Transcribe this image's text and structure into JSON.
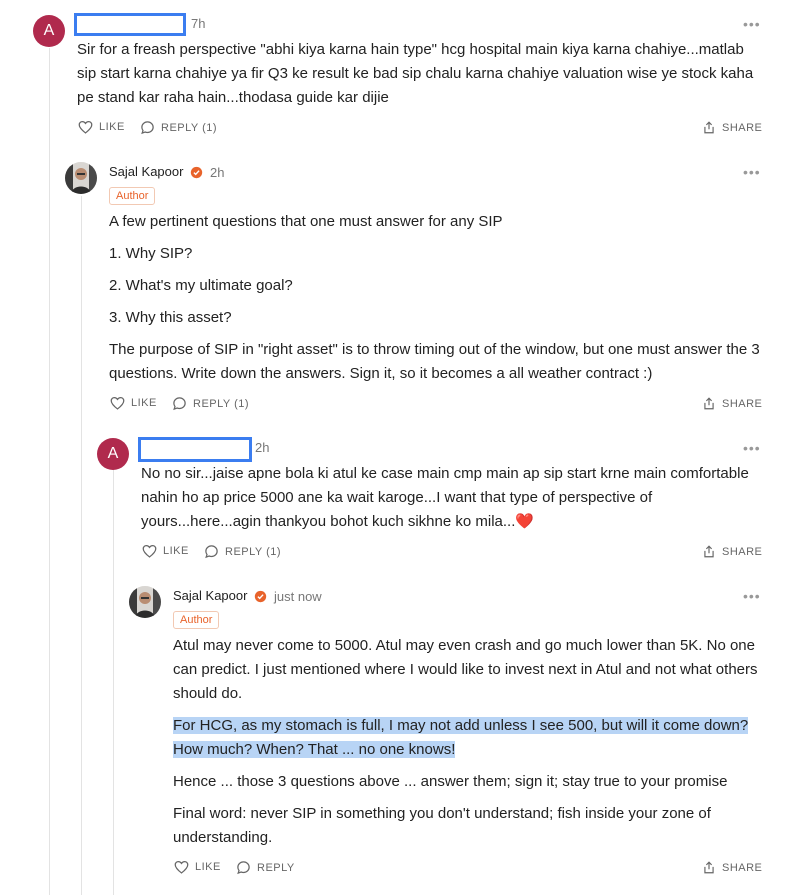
{
  "actions": {
    "like": "LIKE",
    "share": "SHARE"
  },
  "menu_glyph": "•••",
  "comments": [
    {
      "avatar_letter": "A",
      "time": "7h",
      "paragraphs": [
        "Sir for a freash perspective \"abhi kiya karna hain type\" hcg hospital main kiya karna chahiye...matlab sip start karna chahiye ya fir Q3 ke result ke bad sip chalu karna chahiye valuation wise ye stock kaha pe stand kar raha hain...thodasa guide kar dijie"
      ],
      "reply_label": "REPLY (1)"
    },
    {
      "author": "Sajal Kapoor",
      "time": "2h",
      "badge": "Author",
      "paragraphs": [
        "A few pertinent questions that one must answer for any SIP",
        "1. Why SIP?",
        "2. What's my ultimate goal?",
        "3. Why this asset?",
        "The purpose of SIP in \"right asset\" is to throw timing out of the window, but one must answer the 3 questions. Write down the answers. Sign it, so it becomes a all weather contract :)"
      ],
      "reply_label": "REPLY (1)"
    },
    {
      "avatar_letter": "A",
      "time": "2h",
      "paragraphs": [
        "No no sir...jaise apne bola ki atul ke case main cmp main ap sip start krne main comfortable nahin ho ap price 5000 ane ka wait karoge...I want that type of perspective of yours...here...agin thankyou bohot kuch sikhne ko mila..."
      ],
      "heart": "❤️",
      "reply_label": "REPLY (1)"
    },
    {
      "author": "Sajal Kapoor",
      "time": "just now",
      "badge": "Author",
      "paragraphs": [
        "Atul may never come to 5000. Atul may even crash and go much lower than 5K. No one can predict. I just mentioned where I would like to invest next in Atul and not what others should do.",
        "For HCG, as my stomach is full, I may not add unless I see 500, but will it come down? How much? When? That ... no one knows!",
        "Hence ... those 3 questions above ... answer them; sign it; stay true to your promise",
        "Final word: never SIP in something you don't understand; fish inside your zone of understanding."
      ],
      "reply_label": "REPLY"
    }
  ]
}
